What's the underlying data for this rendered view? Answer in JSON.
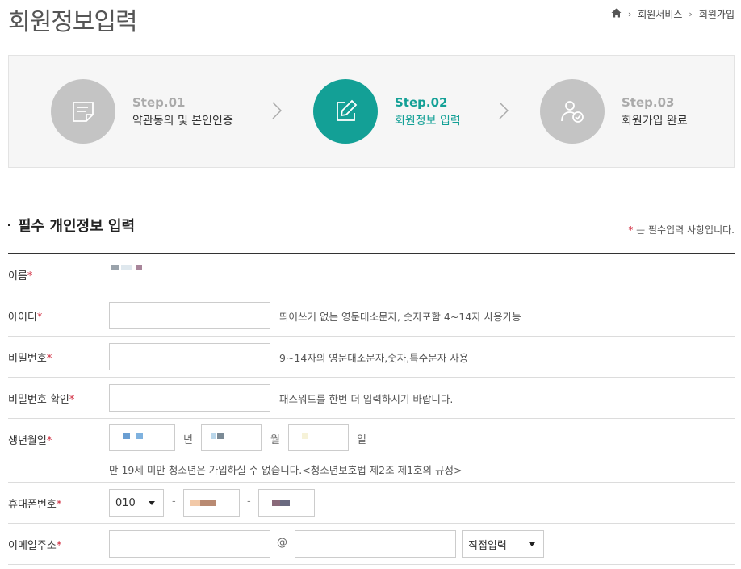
{
  "header": {
    "title": "회원정보입력",
    "breadcrumb": [
      "회원서비스",
      "회원가입"
    ]
  },
  "steps": [
    {
      "num": "Step.01",
      "name": "약관동의 및 본인인증",
      "icon": "document-icon",
      "active": false
    },
    {
      "num": "Step.02",
      "name": "회원정보 입력",
      "icon": "edit-icon",
      "active": true
    },
    {
      "num": "Step.03",
      "name": "회원가입 완료",
      "icon": "user-check-icon",
      "active": false
    }
  ],
  "section": {
    "title": "필수 개인정보 입력",
    "required_note_star": "*",
    "required_note": " 는 필수입력 사항입니다."
  },
  "form": {
    "name": {
      "label": "이름",
      "star": "*"
    },
    "id": {
      "label": "아이디",
      "star": "*",
      "help": "띄어쓰기 없는 영문대소문자, 숫자포함 4~14자 사용가능"
    },
    "password": {
      "label": "비밀번호",
      "star": "*",
      "help": "9~14자의 영문대소문자,숫자,특수문자 사용"
    },
    "password_confirm": {
      "label": "비밀번호 확인",
      "star": "*",
      "help": "패스워드를 한번 더 입력하시기 바랍니다."
    },
    "birth": {
      "label": "생년월일",
      "star": "*",
      "year_unit": "년",
      "month_unit": "월",
      "day_unit": "일",
      "note": "만 19세 미만 청소년은 가입하실 수 없습니다.<청소년보호법 제2조 제1호의 규정>"
    },
    "phone": {
      "label": "휴대폰번호",
      "star": "*",
      "prefix": "010",
      "dash": "-"
    },
    "email": {
      "label": "이메일주소",
      "star": "*",
      "at": "@",
      "domain_select": "직접입력"
    }
  },
  "colors": {
    "accent": "#13a096",
    "required": "#d0283c",
    "inactive_step": "#c4c4c4"
  }
}
